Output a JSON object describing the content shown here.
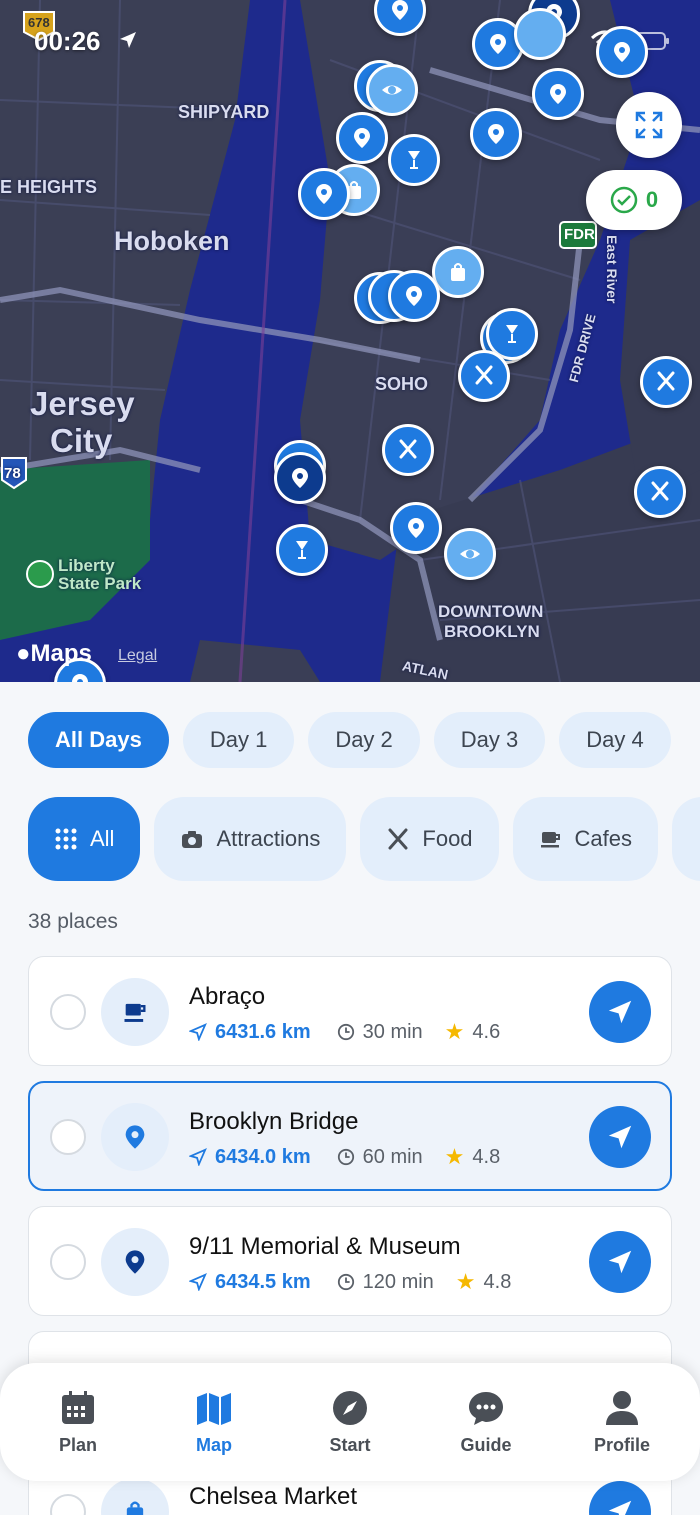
{
  "status": {
    "time": "00:26"
  },
  "map": {
    "labels": {
      "shipyard": "SHIPYARD",
      "heights": "E HEIGHTS",
      "hoboken": "Hoboken",
      "jersey": "Jersey",
      "city": "City",
      "soho": "SOHO",
      "downtown": "DOWNTOWN",
      "brooklyn": "BROOKLYN",
      "liberty1": "Liberty",
      "liberty2": "State Park",
      "fdr": "FDR",
      "east_river": "East River",
      "fdr_drive": "FDR DRIVE",
      "atlantic": "ATLAN",
      "highway_78": "78",
      "highway_678": "678"
    },
    "maps_brand": "Maps",
    "legal": "Legal",
    "completed_count": "0"
  },
  "days": [
    "All Days",
    "Day 1",
    "Day 2",
    "Day 3",
    "Day 4"
  ],
  "categories": [
    {
      "label": "All",
      "icon": "grid-icon"
    },
    {
      "label": "Attractions",
      "icon": "camera-icon"
    },
    {
      "label": "Food",
      "icon": "utensils-icon"
    },
    {
      "label": "Cafes",
      "icon": "coffee-icon"
    }
  ],
  "places_count": "38 places",
  "places": [
    {
      "name": "Abraço",
      "distance": "6431.6 km",
      "duration": "30 min",
      "rating": "4.6",
      "icon": "coffee-icon"
    },
    {
      "name": "Brooklyn Bridge",
      "distance": "6434.0 km",
      "duration": "60 min",
      "rating": "4.8",
      "icon": "location-pin-icon"
    },
    {
      "name": "9/11 Memorial & Museum",
      "distance": "6434.5 km",
      "duration": "120 min",
      "rating": "4.8",
      "icon": "location-pin-icon"
    },
    {
      "name": "Chelsea Market",
      "icon": "shopping-bag-icon"
    }
  ],
  "tabs": [
    {
      "label": "Plan",
      "icon": "calendar-icon"
    },
    {
      "label": "Map",
      "icon": "map-icon"
    },
    {
      "label": "Start",
      "icon": "compass-icon"
    },
    {
      "label": "Guide",
      "icon": "chat-icon"
    },
    {
      "label": "Profile",
      "icon": "person-icon"
    }
  ],
  "colors": {
    "accent": "#1f7ae0",
    "map_water": "#1e2a8c",
    "success": "#2aa84a",
    "star": "#f5b800"
  }
}
